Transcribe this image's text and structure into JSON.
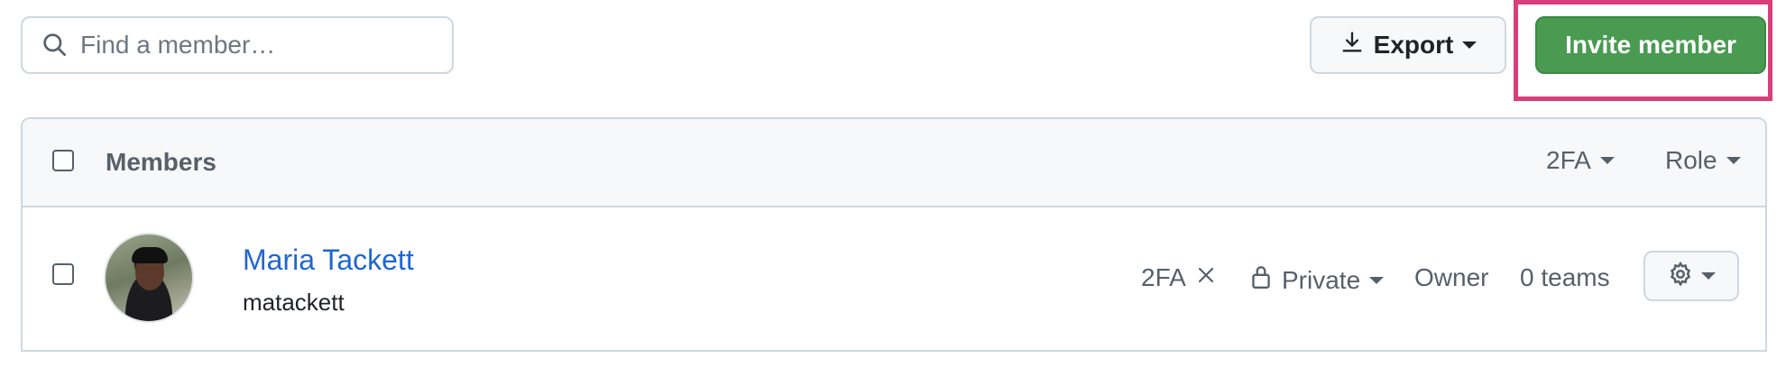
{
  "toolbar": {
    "search_placeholder": "Find a member…",
    "search_icon": "search-icon",
    "export_label": "Export",
    "export_icon": "download-icon",
    "invite_label": "Invite member"
  },
  "table": {
    "header_title": "Members",
    "filter_2fa": "2FA",
    "filter_role": "Role",
    "members": [
      {
        "name": "Maria Tackett",
        "username": "matackett",
        "twofa": "2FA",
        "twofa_status_icon": "x-icon",
        "visibility": "Private",
        "role": "Owner",
        "teams": "0 teams"
      }
    ]
  },
  "colors": {
    "accent_green": "#4a9a52",
    "highlight_pink": "#d83f7a",
    "link_blue": "#1f66d3"
  }
}
